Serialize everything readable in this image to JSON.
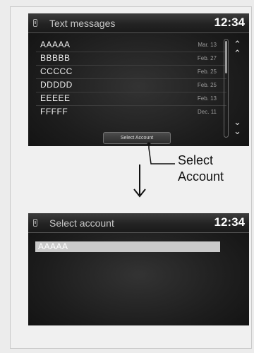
{
  "top_screen": {
    "title": "Text messages",
    "clock": "12:34",
    "messages": [
      {
        "name": "AAAAA",
        "date": "Mar. 13"
      },
      {
        "name": "BBBBB",
        "date": "Feb. 27"
      },
      {
        "name": "CCCCC",
        "date": "Feb. 25"
      },
      {
        "name": "DDDDD",
        "date": "Feb. 25"
      },
      {
        "name": "EEEEE",
        "date": "Feb. 13"
      },
      {
        "name": "FFFFF",
        "date": "Dec. 11"
      }
    ],
    "select_button": "Select Account"
  },
  "callout": {
    "line1": "Select",
    "line2": "Account"
  },
  "bottom_screen": {
    "title": "Select account",
    "clock": "12:34",
    "accounts": [
      "AAAAA"
    ]
  }
}
